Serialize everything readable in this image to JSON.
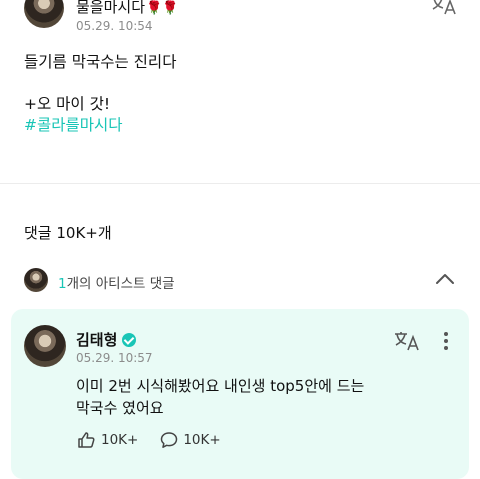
{
  "post": {
    "author": "물을마시다",
    "author_emoji": "🌹🌹",
    "date": "05.29. 10:54",
    "body_lines": [
      "들기름 막국수는 진리다",
      "",
      "+오 마이 갓!"
    ],
    "hashtag": "#콜라를마시다"
  },
  "comments": {
    "count_label": "댓글 10K+개",
    "artist_count": "1",
    "artist_label": "개의 아티스트 댓글"
  },
  "comment": {
    "author": "김태형",
    "date": "05.29. 10:57",
    "body_lines": [
      "이미 2번 시식해봤어요 내인생 top5안에 드는",
      "막국수 였어요"
    ],
    "likes": "10K+",
    "replies": "10K+"
  },
  "icons": {
    "translate": "translate-icon",
    "chevron": "chevron-up-icon",
    "more": "more-vertical-icon",
    "like": "like-icon",
    "reply": "reply-icon",
    "verified": "verified-badge-icon"
  },
  "colors": {
    "accent": "#19c5b6",
    "card_bg": "#e9fbf6"
  }
}
